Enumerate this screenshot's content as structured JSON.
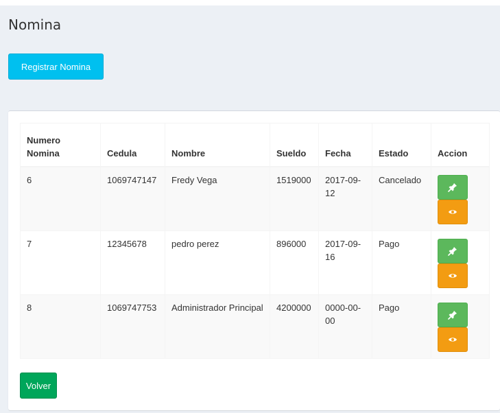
{
  "page": {
    "title": "Nomina"
  },
  "toolbar": {
    "register_label": "Registrar Nomina"
  },
  "table": {
    "headers": [
      "Numero Nomina",
      "Cedula",
      "Nombre",
      "Sueldo",
      "Fecha",
      "Estado",
      "Accion"
    ],
    "rows": [
      {
        "numero": "6",
        "cedula": "1069747147",
        "nombre": "Fredy Vega",
        "sueldo": "1519000",
        "fecha": "2017-09-12",
        "estado": "Cancelado"
      },
      {
        "numero": "7",
        "cedula": "12345678",
        "nombre": "pedro perez",
        "sueldo": "896000",
        "fecha": "2017-09-16",
        "estado": "Pago"
      },
      {
        "numero": "8",
        "cedula": "1069747753",
        "nombre": "Administrador Principal",
        "sueldo": "4200000",
        "fecha": "0000-00-00",
        "estado": "Pago"
      }
    ],
    "action_icons": {
      "edit": "pin-icon",
      "view": "eye-icon"
    }
  },
  "footer": {
    "back_label": "Volver"
  },
  "colors": {
    "background": "#ecf0f5",
    "info": "#00c0ef",
    "success": "#00a65a",
    "edit": "#5cb85c",
    "view": "#f39c12"
  }
}
